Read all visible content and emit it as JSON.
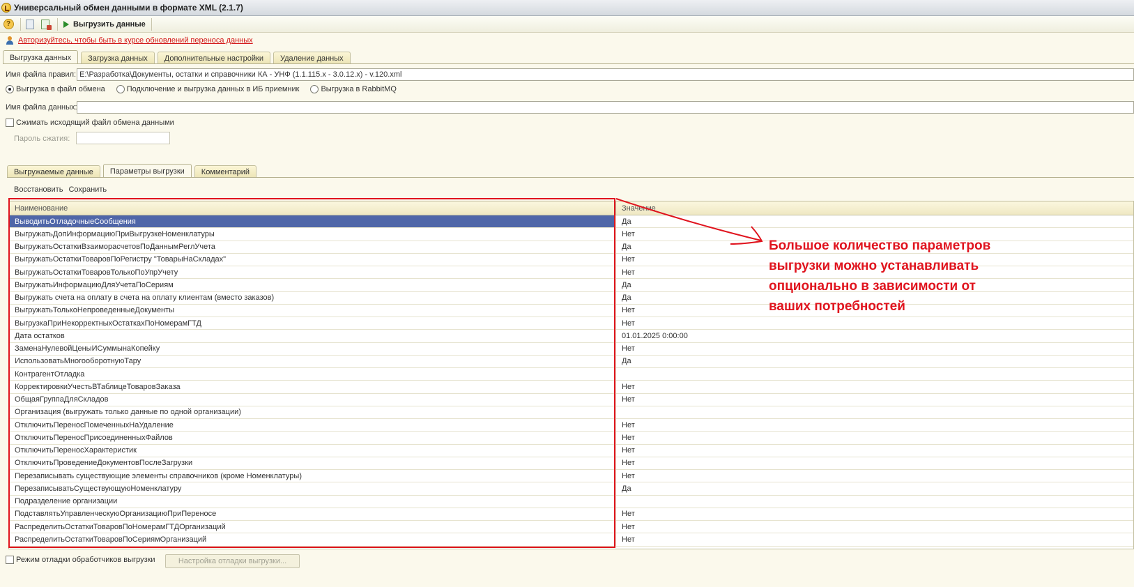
{
  "window": {
    "title": "Универсальный обмен данными в формате XML (2.1.7)"
  },
  "toolbar": {
    "run_label": "Выгрузить данные"
  },
  "auth_link": "Авторизуйтесь, чтобы быть в курсе обновлений переноса данных",
  "main_tabs": [
    {
      "label": "Выгрузка данных"
    },
    {
      "label": "Загрузка данных"
    },
    {
      "label": "Дополнительные настройки"
    },
    {
      "label": "Удаление данных"
    }
  ],
  "rules_file": {
    "label": "Имя файла правил:",
    "value": "E:\\Разработка\\Документы, остатки и справочники КА - УНФ (1.1.115.x - 3.0.12.x) - v.120.xml"
  },
  "radios": [
    {
      "label": "Выгрузка в файл обмена"
    },
    {
      "label": "Подключение и выгрузка данных в ИБ приемник"
    },
    {
      "label": "Выгрузка в RabbitMQ"
    }
  ],
  "data_file": {
    "label": "Имя файла данных:",
    "value": ""
  },
  "compress": {
    "label": "Сжимать исходящий файл обмена данными"
  },
  "password": {
    "label": "Пароль сжатия:",
    "value": ""
  },
  "sub_tabs": [
    {
      "label": "Выгружаемые данные"
    },
    {
      "label": "Параметры выгрузки"
    },
    {
      "label": "Комментарий"
    }
  ],
  "commands": {
    "restore": "Восстановить",
    "save": "Сохранить"
  },
  "grid": {
    "col_name": "Наименование",
    "col_value": "Значение",
    "rows": [
      {
        "name": "ВыводитьОтладочныеСообщения",
        "value": "Да"
      },
      {
        "name": "ВыгружатьДопИнформациюПриВыгрузкеНоменклатуры",
        "value": "Нет"
      },
      {
        "name": "ВыгружатьОстаткиВзаиморасчетовПоДаннымРеглУчета",
        "value": "Да"
      },
      {
        "name": "ВыгружатьОстаткиТоваровПоРегистру \"ТоварыНаСкладах\"",
        "value": "Нет"
      },
      {
        "name": "ВыгружатьОстаткиТоваровТолькоПоУпрУчету",
        "value": "Нет"
      },
      {
        "name": "ВыгружатьИнформациюДляУчетаПоСериям",
        "value": "Да"
      },
      {
        "name": "Выгружать счета на оплату в счета на оплату клиентам (вместо заказов)",
        "value": "Да"
      },
      {
        "name": "ВыгружатьТолькоНепроведенныеДокументы",
        "value": "Нет"
      },
      {
        "name": "ВыгрузкаПриНекорректныхОстаткахПоНомерамГТД",
        "value": "Нет"
      },
      {
        "name": "Дата остатков",
        "value": "01.01.2025 0:00:00"
      },
      {
        "name": "ЗаменаНулевойЦеныИСуммынаКопейку",
        "value": "Нет"
      },
      {
        "name": "ИспользоватьМногооборотнуюТару",
        "value": "Да"
      },
      {
        "name": "КонтрагентОтладка",
        "value": ""
      },
      {
        "name": "КорректировкиУчестьВТаблицеТоваровЗаказа",
        "value": "Нет"
      },
      {
        "name": "ОбщаяГруппаДляСкладов",
        "value": "Нет"
      },
      {
        "name": "Организация (выгружать только данные по одной организации)",
        "value": ""
      },
      {
        "name": "ОтключитьПереносПомеченныхНаУдаление",
        "value": "Нет"
      },
      {
        "name": "ОтключитьПереносПрисоединенныхФайлов",
        "value": "Нет"
      },
      {
        "name": "ОтключитьПереносХарактеристик",
        "value": "Нет"
      },
      {
        "name": "ОтключитьПроведениеДокументовПослеЗагрузки",
        "value": "Нет"
      },
      {
        "name": "Перезаписывать существующие элементы справочников (кроме Номенклатуры)",
        "value": "Нет"
      },
      {
        "name": "ПерезаписыватьСуществующуюНоменклатуру",
        "value": "Да"
      },
      {
        "name": "Подразделение организации",
        "value": ""
      },
      {
        "name": "ПодставлятьУправленческуюОрганизациюПриПереносе",
        "value": "Нет"
      },
      {
        "name": "РаспределитьОстаткиТоваровПоНомерамГТДОрганизаций",
        "value": "Нет"
      },
      {
        "name": "РаспределитьОстаткиТоваровПоСериямОрганизаций",
        "value": "Нет"
      }
    ]
  },
  "annotation": {
    "lines": [
      "Большое количество параметров",
      "выгрузки можно устанавливать",
      "опционально в зависимости от",
      "ваших потребностей"
    ],
    "color": "#e0141e"
  },
  "bottom": {
    "debug_label": "Режим отладки обработчиков выгрузки",
    "debug_button": "Настройка отладки выгрузки..."
  }
}
